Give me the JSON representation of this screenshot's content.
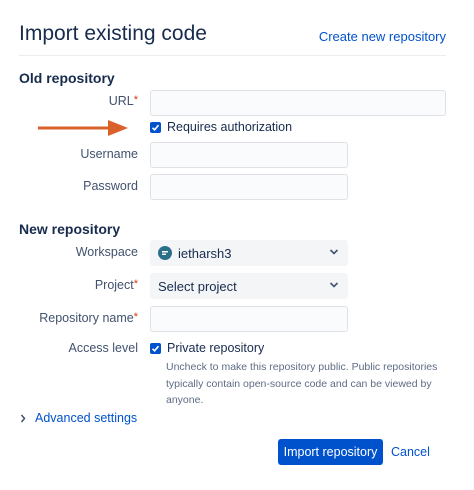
{
  "header": {
    "title": "Import existing code",
    "create_link": "Create new repository"
  },
  "old_repo": {
    "section_title": "Old repository",
    "url_label": "URL",
    "url_value": "",
    "requires_auth_label": "Requires authorization",
    "requires_auth_checked": true,
    "username_label": "Username",
    "username_value": "",
    "password_label": "Password",
    "password_value": ""
  },
  "new_repo": {
    "section_title": "New repository",
    "workspace_label": "Workspace",
    "workspace_value": "ietharsh3",
    "project_label": "Project",
    "project_value": "Select project",
    "repo_name_label": "Repository name",
    "repo_name_value": "",
    "access_label": "Access level",
    "private_label": "Private repository",
    "private_checked": true,
    "private_help": "Uncheck to make this repository public. Public repositories typically contain open-source code and can be viewed by anyone."
  },
  "advanced": {
    "label": "Advanced settings"
  },
  "actions": {
    "import_label": "Import repository",
    "cancel_label": "Cancel"
  },
  "colors": {
    "accent": "#0052cc",
    "required": "#de350b",
    "arrow": "#d9622b"
  }
}
